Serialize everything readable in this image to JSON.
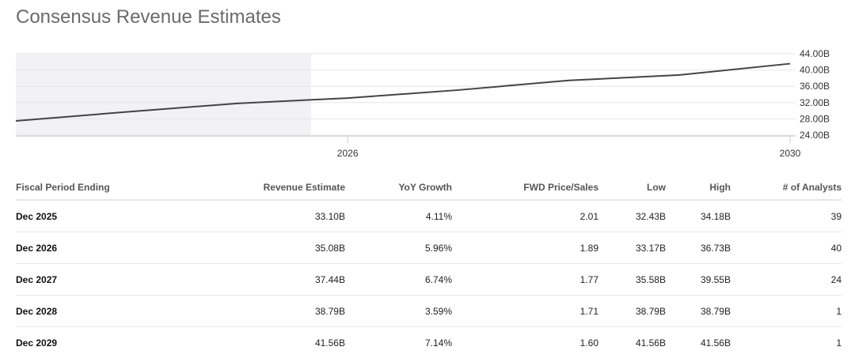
{
  "title": "Consensus Revenue Estimates",
  "chart_data": {
    "type": "line",
    "title": "Consensus Revenue Estimates",
    "x": [
      2023.0,
      2024.0,
      2025.0,
      2026.0,
      2027.0,
      2028.0,
      2029.0,
      2030.0
    ],
    "values": [
      27.5,
      29.7,
      31.8,
      33.1,
      35.08,
      37.44,
      38.79,
      41.56
    ],
    "xlim": [
      2023.0,
      2030.05
    ],
    "ylim": [
      24,
      44
    ],
    "x_ticks": [
      {
        "value": 2026,
        "label": "2026"
      },
      {
        "value": 2030,
        "label": "2030"
      }
    ],
    "y_ticks": [
      {
        "value": 44,
        "label": "44.00B"
      },
      {
        "value": 40,
        "label": "40.00B"
      },
      {
        "value": 36,
        "label": "36.00B"
      },
      {
        "value": 32,
        "label": "32.00B"
      },
      {
        "value": 28,
        "label": "28.00B"
      },
      {
        "value": 24,
        "label": "24.00B"
      }
    ],
    "shaded_until": 2025.67,
    "grid": true,
    "colors": {
      "line": "#444444",
      "shade": "#f2f2f5",
      "grid": "#e6e6e6"
    }
  },
  "table": {
    "headers": [
      "Fiscal Period Ending",
      "Revenue Estimate",
      "YoY Growth",
      "FWD Price/Sales",
      "Low",
      "High",
      "# of Analysts"
    ],
    "rows": [
      [
        "Dec 2025",
        "33.10B",
        "4.11%",
        "2.01",
        "32.43B",
        "34.18B",
        "39"
      ],
      [
        "Dec 2026",
        "35.08B",
        "5.96%",
        "1.89",
        "33.17B",
        "36.73B",
        "40"
      ],
      [
        "Dec 2027",
        "37.44B",
        "6.74%",
        "1.77",
        "35.58B",
        "39.55B",
        "24"
      ],
      [
        "Dec 2028",
        "38.79B",
        "3.59%",
        "1.71",
        "38.79B",
        "38.79B",
        "1"
      ],
      [
        "Dec 2029",
        "41.56B",
        "7.14%",
        "1.60",
        "41.56B",
        "41.56B",
        "1"
      ]
    ]
  }
}
